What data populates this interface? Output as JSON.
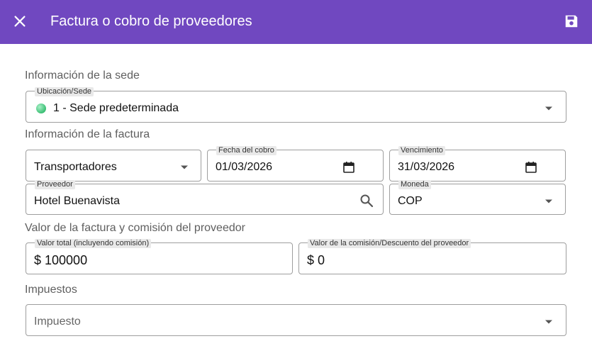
{
  "header": {
    "title": "Factura o cobro de proveedores",
    "close_icon": "close-icon",
    "save_icon": "save-icon",
    "background_color": "#7048c0"
  },
  "sections": {
    "sede": "Información de la sede",
    "factura": "Información de la factura",
    "valor": "Valor de la factura y comisión del proveedor",
    "impuestos": "Impuestos"
  },
  "sede_field": {
    "label": "Ubicación/Sede",
    "value": "1 - Sede predeterminada",
    "status_color": "#3bbf74"
  },
  "tipo_field": {
    "value": "Transportadores"
  },
  "fecha_cobro": {
    "label": "Fecha del cobro",
    "value": "01/03/2026"
  },
  "vencimiento": {
    "label": "Vencimiento",
    "value": "31/03/2026"
  },
  "proveedor": {
    "label": "Proveedor",
    "value": "Hotel Buenavista"
  },
  "moneda": {
    "label": "Moneda",
    "value": "COP"
  },
  "valor_total": {
    "label": "Valor total (incluyendo comisión)",
    "value": "$ 100000"
  },
  "valor_comision": {
    "label": "Valor de la comisión/Descuento del proveedor",
    "value": "$ 0"
  },
  "impuesto": {
    "placeholder": "Impuesto"
  }
}
